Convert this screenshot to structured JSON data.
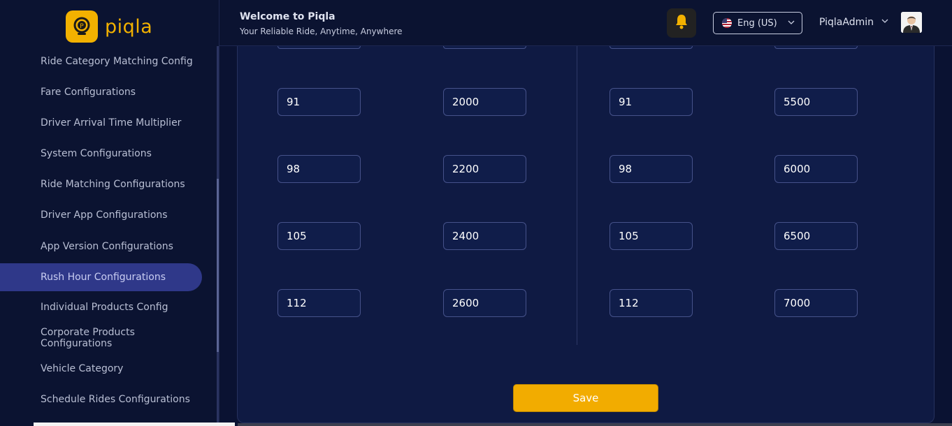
{
  "brand": {
    "name": "piqla",
    "color": "#f2b100"
  },
  "sidebar": {
    "items": [
      {
        "label": "Ride Category Matching Config"
      },
      {
        "label": "Fare Configurations"
      },
      {
        "label": "Driver Arrival Time Multiplier"
      },
      {
        "label": "System Configurations"
      },
      {
        "label": "Ride Matching Configurations"
      },
      {
        "label": "Driver App Configurations"
      },
      {
        "label": "App Version Configurations"
      },
      {
        "label": "Rush Hour Configurations",
        "active": true
      },
      {
        "label": "Individual Products Config"
      },
      {
        "label": "Corporate Products Configurations"
      },
      {
        "label": "Vehicle Category"
      },
      {
        "label": "Schedule Rides Configurations"
      }
    ]
  },
  "header": {
    "title": "Welcome to Piqla",
    "subtitle": "Your Reliable Ride, Anytime, Anywhere",
    "notification_icon": "bell-icon",
    "language": "Eng (US)",
    "user": "PiqlaAdmin"
  },
  "grid": {
    "rows": [
      [
        "91",
        "2000",
        "91",
        "5500"
      ],
      [
        "98",
        "2200",
        "98",
        "6000"
      ],
      [
        "105",
        "2400",
        "105",
        "6500"
      ],
      [
        "112",
        "2600",
        "112",
        "7000"
      ]
    ]
  },
  "actions": {
    "save_label": "Save"
  },
  "colors": {
    "accent": "#f2ac00",
    "active_nav": "#2f3889",
    "background": "#0a1232"
  }
}
